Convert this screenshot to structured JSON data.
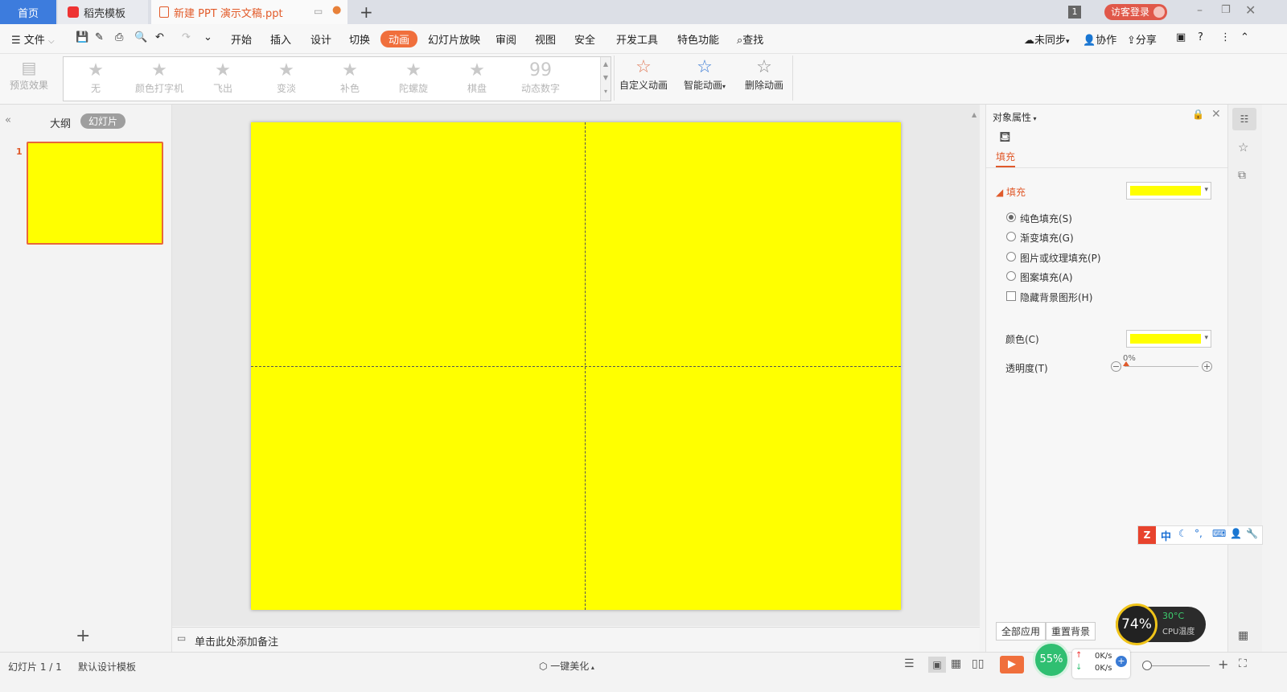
{
  "tabs": {
    "home": "首页",
    "template": "稻壳模板",
    "doc": "新建 PPT 演示文稿.ppt",
    "badge": "1",
    "login": "访客登录"
  },
  "menu": {
    "file": "文件",
    "items": [
      "开始",
      "插入",
      "设计",
      "切换",
      "动画",
      "幻灯片放映",
      "审阅",
      "视图",
      "安全",
      "开发工具",
      "特色功能"
    ],
    "search": "查找",
    "unsync": "未同步",
    "collab": "协作",
    "share": "分享"
  },
  "ribbon": {
    "preview": "预览效果",
    "gallery": [
      "无",
      "颜色打字机",
      "飞出",
      "变淡",
      "补色",
      "陀螺旋",
      "棋盘",
      "动态数字"
    ],
    "custom": "自定义动画",
    "smart": "智能动画",
    "delete": "删除动画"
  },
  "left": {
    "outline": "大纲",
    "slides": "幻灯片",
    "slide_number": "1"
  },
  "notes": {
    "placeholder": "单击此处添加备注"
  },
  "panel": {
    "title": "对象属性",
    "tab_fill": "填充",
    "section_fill": "填充",
    "fill_color": "#ffff00",
    "options": [
      "纯色填充(S)",
      "渐变填充(G)",
      "图片或纹理填充(P)",
      "图案填充(A)"
    ],
    "hide_bg": "隐藏背景图形(H)",
    "color_label": "颜色(C)",
    "transparency_label": "透明度(T)",
    "transparency_value": "0%",
    "apply_all": "全部应用",
    "reset": "重置背景"
  },
  "status": {
    "slide": "幻灯片 1 / 1",
    "design": "默认设计模板",
    "beautify": "一键美化",
    "speed_pct": "55%",
    "up": "0K/s",
    "down": "0K/s",
    "cpu_pct": "74%",
    "cpu_temp": "30°C",
    "cpu_label": "CPU温度"
  },
  "ime": {
    "zh": "中"
  }
}
